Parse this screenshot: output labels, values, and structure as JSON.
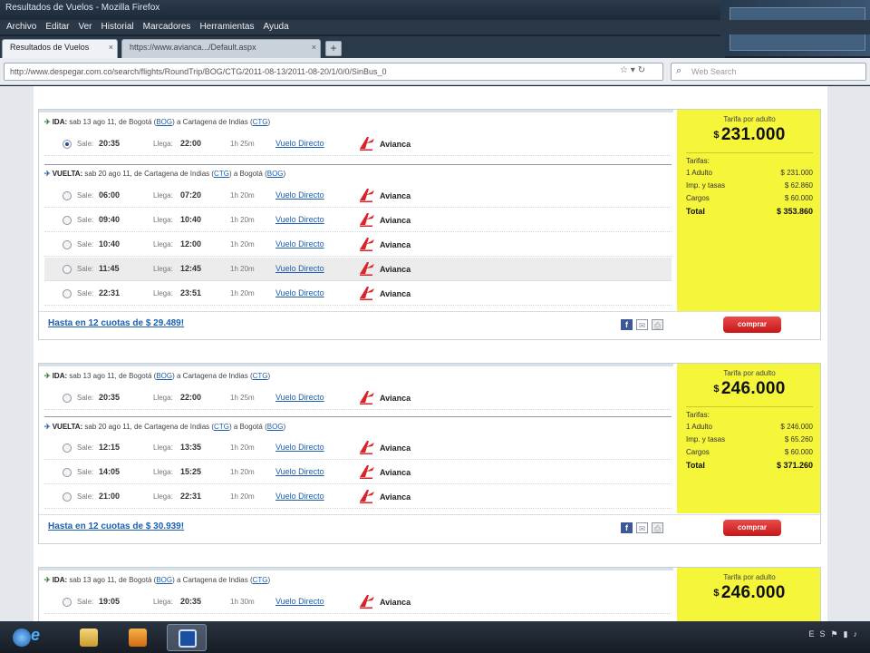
{
  "window": {
    "title": "Resultados de Vuelos - Mozilla Firefox",
    "menu": [
      "Archivo",
      "Editar",
      "Ver",
      "Historial",
      "Marcadores",
      "Herramientas",
      "Ayuda"
    ]
  },
  "tabs": [
    {
      "label": "Resultados de Vuelos",
      "close": "×"
    },
    {
      "label": "https://www.avianca.../Default.aspx",
      "close": "×"
    }
  ],
  "newtab": "+",
  "navbar": {
    "url": "http://www.despegar.com.co/search/flights/RoundTrip/BOG/CTG/2011-08-13/2011-08-20/1/0/0/SinBus_0",
    "search_placeholder": "Web Search"
  },
  "labels": {
    "ida": "IDA:",
    "vuelta": "VUELTA:",
    "sale": "Sale:",
    "llega": "Llega:",
    "vuelo": "Vuelo Directo",
    "airline": "Avianca",
    "comprar": "comprar",
    "price_label": "Tarifa por adulto",
    "tarifas": "Tarifas:",
    "adulto": "1 Adulto",
    "imp": "Imp. y tasas",
    "cargos": "Cargos",
    "total": "Total",
    "currency": "$"
  },
  "results": [
    {
      "ida": {
        "text": "sab 13 ago 11, de Bogotá (",
        "code1": "BOG",
        "mid": ") a Cartagena de Indias (",
        "code2": "CTG",
        "end": ")"
      },
      "ida_flights": [
        {
          "sale": "20:35",
          "llega": "22:00",
          "dur": "1h 25m"
        }
      ],
      "vuelta": {
        "text": "sab 20 ago 11, de Cartagena de Indias (",
        "code1": "CTG",
        "mid": ") a Bogotá (",
        "code2": "BOG",
        "end": ")"
      },
      "vuelta_flights": [
        {
          "sale": "06:00",
          "llega": "07:20",
          "dur": "1h 20m"
        },
        {
          "sale": "09:40",
          "llega": "10:40",
          "dur": "1h 20m"
        },
        {
          "sale": "10:40",
          "llega": "12:00",
          "dur": "1h 20m"
        },
        {
          "sale": "11:45",
          "llega": "12:45",
          "dur": "1h 20m"
        },
        {
          "sale": "22:31",
          "llega": "23:51",
          "dur": "1h 20m"
        }
      ],
      "price": "231.000",
      "adulto": "$ 231.000",
      "imp": "$ 62.860",
      "cargos": "$ 60.000",
      "total": "$ 353.860",
      "cuotas": "Hasta en 12 cuotas de  $ 29.489!"
    },
    {
      "ida": {
        "text": "sab 13 ago 11, de Bogotá (",
        "code1": "BOG",
        "mid": ") a Cartagena de Indias (",
        "code2": "CTG",
        "end": ")"
      },
      "ida_flights": [
        {
          "sale": "20:35",
          "llega": "22:00",
          "dur": "1h 25m"
        }
      ],
      "vuelta": {
        "text": "sab 20 ago 11, de Cartagena de Indias (",
        "code1": "CTG",
        "mid": ") a Bogotá (",
        "code2": "BOG",
        "end": ")"
      },
      "vuelta_flights": [
        {
          "sale": "12:15",
          "llega": "13:35",
          "dur": "1h 20m"
        },
        {
          "sale": "14:05",
          "llega": "15:25",
          "dur": "1h 20m"
        },
        {
          "sale": "21:00",
          "llega": "22:31",
          "dur": "1h 20m"
        }
      ],
      "price": "246.000",
      "adulto": "$ 246.000",
      "imp": "$ 65.260",
      "cargos": "$ 60.000",
      "total": "$ 371.260",
      "cuotas": "Hasta en 12 cuotas de  $ 30.939!"
    },
    {
      "ida": {
        "text": "sab 13 ago 11, de Bogotá (",
        "code1": "BOG",
        "mid": ") a Cartagena de Indias (",
        "code2": "CTG",
        "end": ")"
      },
      "ida_flights": [
        {
          "sale": "19:05",
          "llega": "20:35",
          "dur": "1h 30m"
        }
      ],
      "price": "246.000"
    }
  ],
  "taskbar": {
    "lang": "ES"
  }
}
